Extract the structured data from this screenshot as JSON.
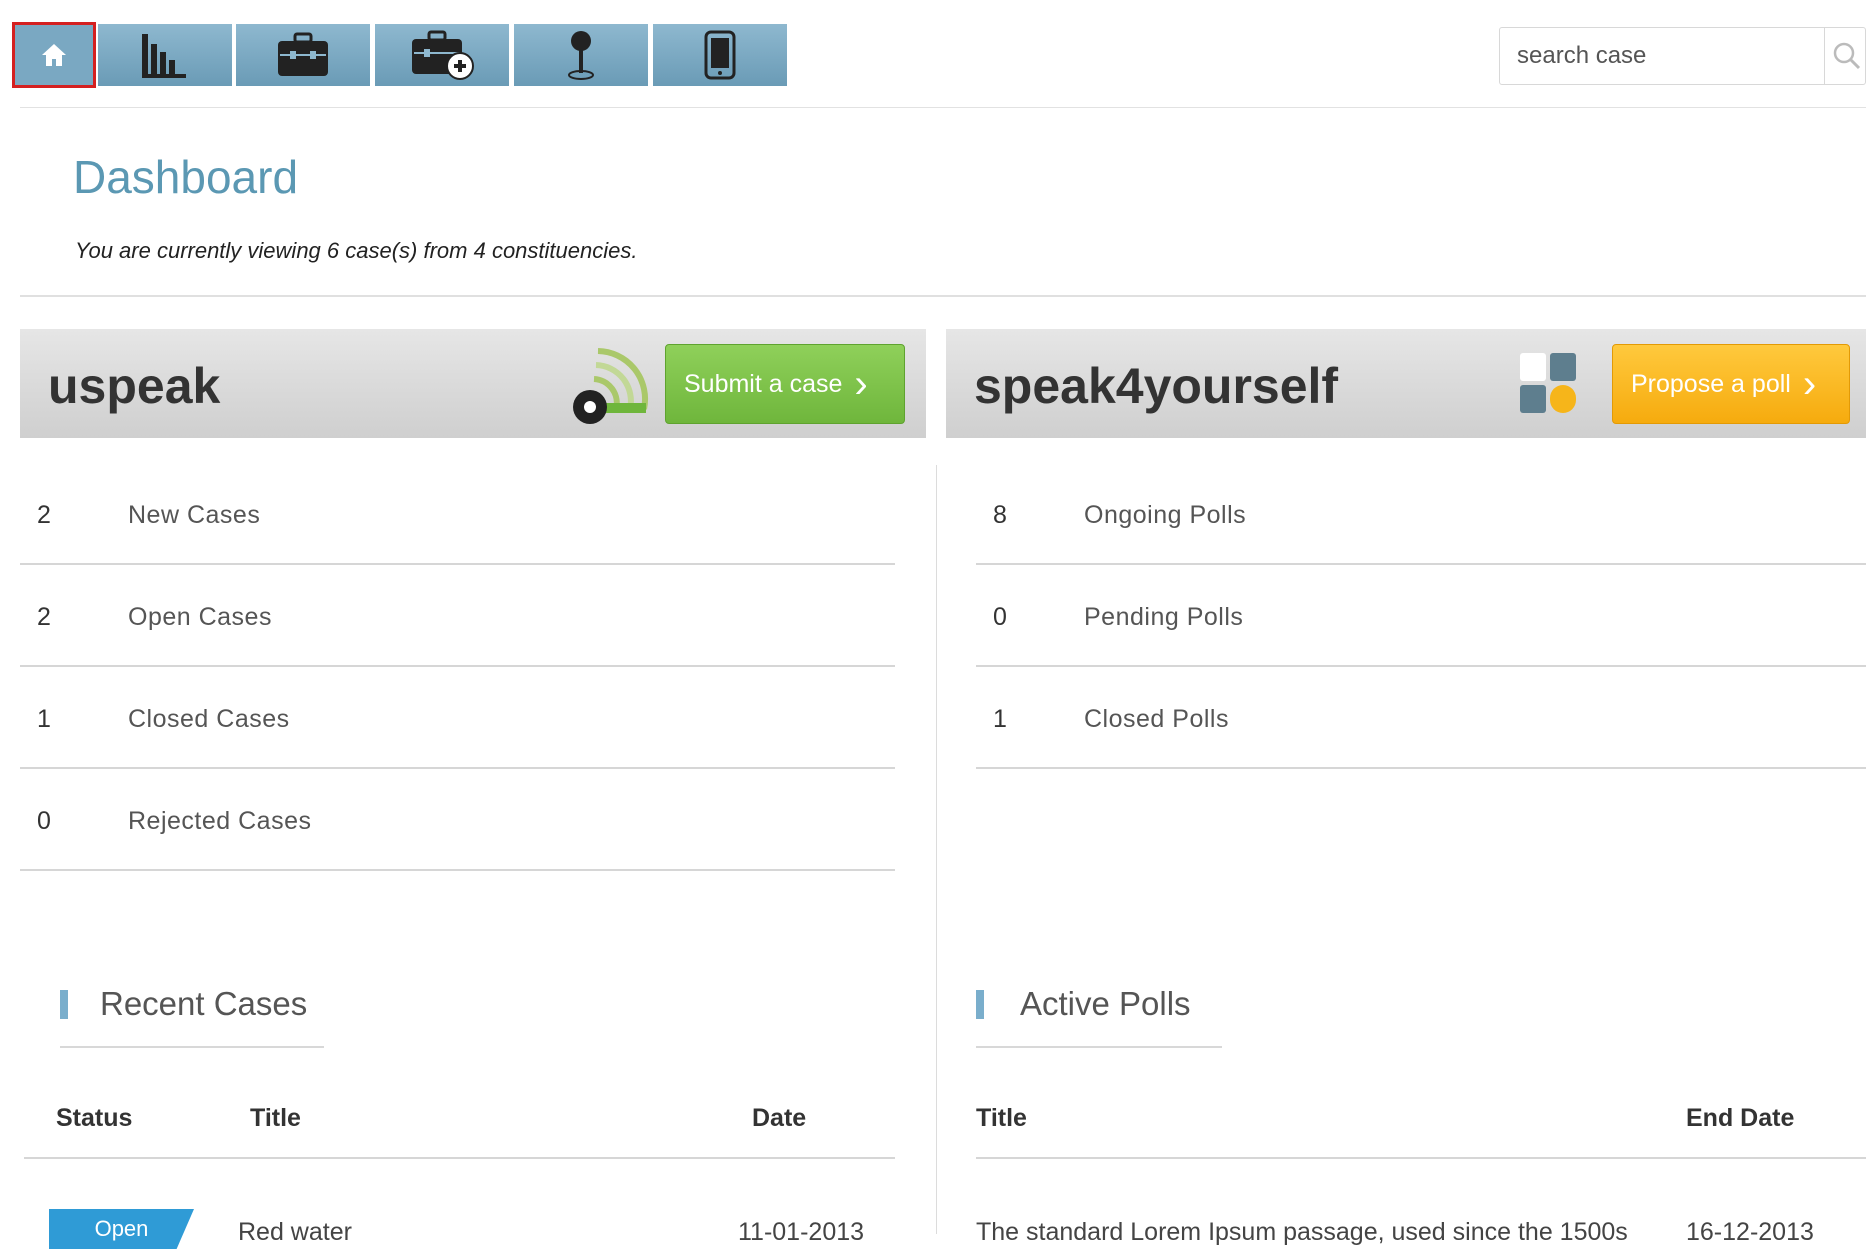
{
  "nav": {
    "items": [
      {
        "icon": "home-icon",
        "active": true
      },
      {
        "icon": "bar-chart-icon",
        "active": false
      },
      {
        "icon": "briefcase-icon",
        "active": false
      },
      {
        "icon": "briefcase-add-icon",
        "active": false
      },
      {
        "icon": "map-pin-icon",
        "active": false
      },
      {
        "icon": "mobile-phone-icon",
        "active": false
      }
    ],
    "search": {
      "placeholder": "search case",
      "icon": "search-icon"
    }
  },
  "dashboard": {
    "title": "Dashboard",
    "subtitle": "You are currently viewing 6 case(s) from 4 constituencies."
  },
  "uspeak": {
    "name": "uspeak",
    "icon": "broadcast-megaphone-icon",
    "cta": "Submit a case",
    "cta_color": "#6fb63c",
    "stats": [
      {
        "count": "2",
        "label": "New Cases"
      },
      {
        "count": "2",
        "label": "Open Cases"
      },
      {
        "count": "1",
        "label": "Closed Cases"
      },
      {
        "count": "0",
        "label": "Rejected Cases"
      }
    ],
    "recent": {
      "title": "Recent Cases",
      "headers": {
        "status": "Status",
        "title": "Title",
        "date": "Date"
      },
      "rows": [
        {
          "status": "Open",
          "title": "Red water",
          "date": "11-01-2013"
        }
      ]
    }
  },
  "speak4yourself": {
    "name": "speak4yourself",
    "icon": "poll-blocks-icon",
    "cta": "Propose a poll",
    "cta_color": "#f6ab0e",
    "stats": [
      {
        "count": "8",
        "label": "Ongoing Polls"
      },
      {
        "count": "0",
        "label": "Pending Polls"
      },
      {
        "count": "1",
        "label": "Closed Polls"
      }
    ],
    "active": {
      "title": "Active Polls",
      "headers": {
        "title": "Title",
        "end_date": "End Date"
      },
      "rows": [
        {
          "title": "The standard Lorem Ipsum passage, used since the 1500s",
          "end_date": "16-12-2013"
        }
      ]
    }
  },
  "colors": {
    "accent": "#5b98b3",
    "nav_button": "#7aa8c2",
    "active_outline": "#d42020",
    "status_open": "#2f9bd6"
  }
}
